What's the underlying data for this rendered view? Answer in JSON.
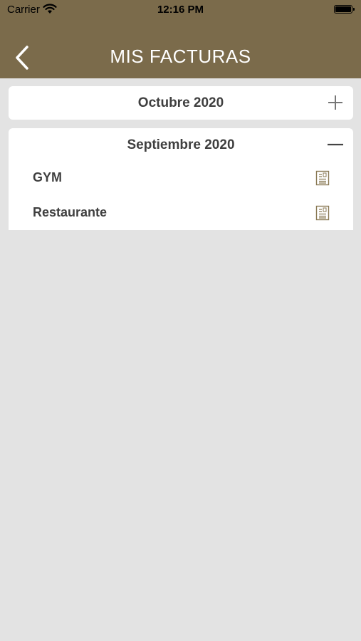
{
  "status_bar": {
    "carrier": "Carrier",
    "time": "12:16 PM"
  },
  "nav": {
    "title": "MIS FACTURAS"
  },
  "months": [
    {
      "label": "Octubre 2020",
      "expanded": false,
      "toggle_icon": "plus-icon"
    },
    {
      "label": "Septiembre 2020",
      "expanded": true,
      "toggle_icon": "minus-icon",
      "invoices": [
        {
          "label": "GYM",
          "icon": "invoice-document-icon"
        },
        {
          "label": "Restaurante",
          "icon": "invoice-document-icon"
        }
      ]
    }
  ],
  "colors": {
    "header": "#7b6b4b",
    "background": "#e3e3e3",
    "card": "#ffffff",
    "text": "#3f3f3f",
    "accent": "#8a7a55"
  }
}
